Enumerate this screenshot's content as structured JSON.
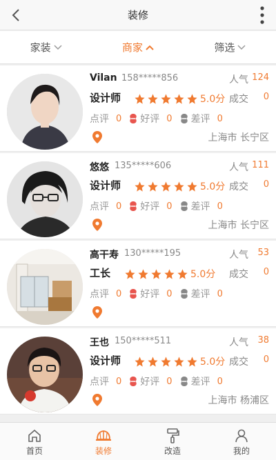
{
  "header": {
    "title": "装修"
  },
  "filters": [
    {
      "label": "家装",
      "active": false
    },
    {
      "label": "商家",
      "active": true
    },
    {
      "label": "筛选",
      "active": false
    }
  ],
  "labels": {
    "popularity": "人气",
    "deals": "成交",
    "score_suffix": "分",
    "review": "点评",
    "good": "好评",
    "bad": "差评"
  },
  "merchants": [
    {
      "name": "Vilan",
      "phone": "158*****856",
      "popularity": "124",
      "role": "设计师",
      "rating": 5,
      "score": "5.0分",
      "deals": "0",
      "reviews": "0",
      "good": "0",
      "bad": "0",
      "location": "上海市 长宁区"
    },
    {
      "name": "悠悠",
      "phone": "135*****606",
      "popularity": "111",
      "role": "设计师",
      "rating": 5,
      "score": "5.0分",
      "deals": "0",
      "reviews": "0",
      "good": "0",
      "bad": "0",
      "location": "上海市 长宁区"
    },
    {
      "name": "高干寿",
      "phone": "130*****195",
      "popularity": "53",
      "role": "工长",
      "rating": 5,
      "score": "5.0分",
      "deals": "0",
      "reviews": "0",
      "good": "0",
      "bad": "0",
      "location": ""
    },
    {
      "name": "王也",
      "phone": "150*****511",
      "popularity": "38",
      "role": "设计师",
      "rating": 5,
      "score": "5.0分",
      "deals": "0",
      "reviews": "0",
      "good": "0",
      "bad": "0",
      "location": "上海市 杨浦区"
    }
  ],
  "tabs": [
    {
      "label": "首页",
      "icon": "home-icon",
      "active": false
    },
    {
      "label": "装修",
      "icon": "helmet-icon",
      "active": true
    },
    {
      "label": "改造",
      "icon": "paint-roller-icon",
      "active": false
    },
    {
      "label": "我的",
      "icon": "person-icon",
      "active": false
    }
  ],
  "colors": {
    "accent": "#f07a30",
    "good_icon": "#e8554e",
    "bad_icon": "#888888"
  }
}
